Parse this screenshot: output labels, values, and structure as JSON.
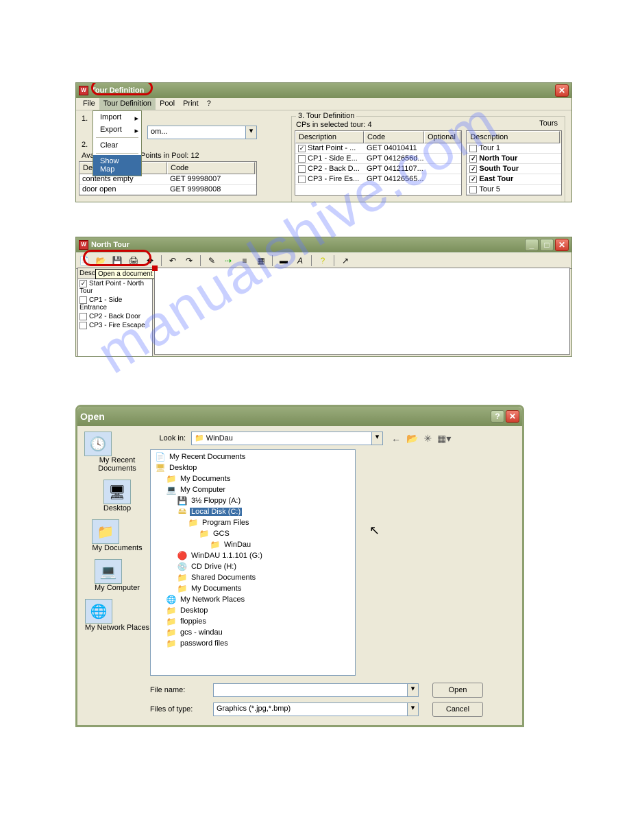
{
  "watermark": "manualshive.com",
  "win1": {
    "title": "Tour Definition",
    "menu": {
      "file": "File",
      "tourdef": "Tour Definition",
      "pool": "Pool",
      "print": "Print",
      "q": "?"
    },
    "dropdown": {
      "import": "Import",
      "export": "Export",
      "clear": "Clear",
      "showmap": "Show Map"
    },
    "step1": "1.",
    "step2": "2.",
    "combo_placeholder": "om...",
    "available_label": "Available Control Points in Pool: 12",
    "left_table": {
      "h_desc": "Description",
      "h_code": "Code",
      "rows": [
        {
          "desc": "contents empty",
          "code": "GET 99998007"
        },
        {
          "desc": "door open",
          "code": "GET 99998008"
        }
      ]
    },
    "section3": "3. Tour Definition",
    "cps_label": "CPs in selected tour: 4",
    "cp_table": {
      "h_desc": "Description",
      "h_code": "Code",
      "h_opt": "Optional",
      "rows": [
        {
          "c": true,
          "desc": "Start Point - ...",
          "code": "GET 04010411"
        },
        {
          "c": false,
          "desc": "CP1 - Side E...",
          "code": "GPT 0412656d..."
        },
        {
          "c": false,
          "desc": "CP2 - Back D...",
          "code": "GPT 04121107..."
        },
        {
          "c": false,
          "desc": "CP3 - Fire Es...",
          "code": "GPT 04126565..."
        }
      ]
    },
    "tours_label": "Tours",
    "tours_table": {
      "h": "Description",
      "rows": [
        {
          "c": false,
          "t": "Tour 1"
        },
        {
          "c": true,
          "t": "North Tour",
          "b": true
        },
        {
          "c": true,
          "t": "South Tour",
          "b": true
        },
        {
          "c": true,
          "t": "East Tour",
          "b": true
        },
        {
          "c": false,
          "t": "Tour 5"
        }
      ]
    }
  },
  "win2": {
    "title": "North Tour",
    "tooltip": "Open a document",
    "list": {
      "h": "Desc",
      "rows": [
        {
          "c": true,
          "t": "Start Point - North Tour"
        },
        {
          "c": false,
          "t": "CP1 - Side Entrance"
        },
        {
          "c": false,
          "t": "CP2 - Back Door"
        },
        {
          "c": false,
          "t": "CP3 - Fire Escape"
        }
      ]
    }
  },
  "win3": {
    "title": "Open",
    "lookin_label": "Look in:",
    "lookin_value": "WinDau",
    "places": {
      "recent": "My Recent Documents",
      "desktop": "Desktop",
      "mydocs": "My Documents",
      "mycomp": "My Computer",
      "netplaces": "My Network Places"
    },
    "tree": [
      {
        "ind": 0,
        "ic": "📄",
        "t": "My Recent Documents"
      },
      {
        "ind": 0,
        "ic": "🖥",
        "t": "Desktop"
      },
      {
        "ind": 1,
        "ic": "📁",
        "t": "My Documents"
      },
      {
        "ind": 1,
        "ic": "💻",
        "t": "My Computer"
      },
      {
        "ind": 2,
        "ic": "💾",
        "t": "3½ Floppy (A:)"
      },
      {
        "ind": 2,
        "ic": "🖴",
        "t": "Local Disk (C:)",
        "sel": true
      },
      {
        "ind": 3,
        "ic": "📁",
        "t": "Program Files"
      },
      {
        "ind": 4,
        "ic": "📁",
        "t": "GCS"
      },
      {
        "ind": 5,
        "ic": "📁",
        "t": "WinDau"
      },
      {
        "ind": 2,
        "ic": "🔴",
        "t": "WinDAU 1.1.101 (G:)"
      },
      {
        "ind": 2,
        "ic": "💿",
        "t": "CD Drive (H:)"
      },
      {
        "ind": 2,
        "ic": "📁",
        "t": "Shared Documents"
      },
      {
        "ind": 2,
        "ic": "📁",
        "t": "My Documents"
      },
      {
        "ind": 1,
        "ic": "🌐",
        "t": "My Network Places"
      },
      {
        "ind": 1,
        "ic": "📁",
        "t": "Desktop"
      },
      {
        "ind": 1,
        "ic": "📁",
        "t": "floppies"
      },
      {
        "ind": 1,
        "ic": "📁",
        "t": "gcs - windau"
      },
      {
        "ind": 1,
        "ic": "📁",
        "t": "password files"
      }
    ],
    "filename_label": "File name:",
    "filename_value": "",
    "filetype_label": "Files of type:",
    "filetype_value": "Graphics (*.jpg,*.bmp)",
    "open_btn": "Open",
    "cancel_btn": "Cancel"
  }
}
